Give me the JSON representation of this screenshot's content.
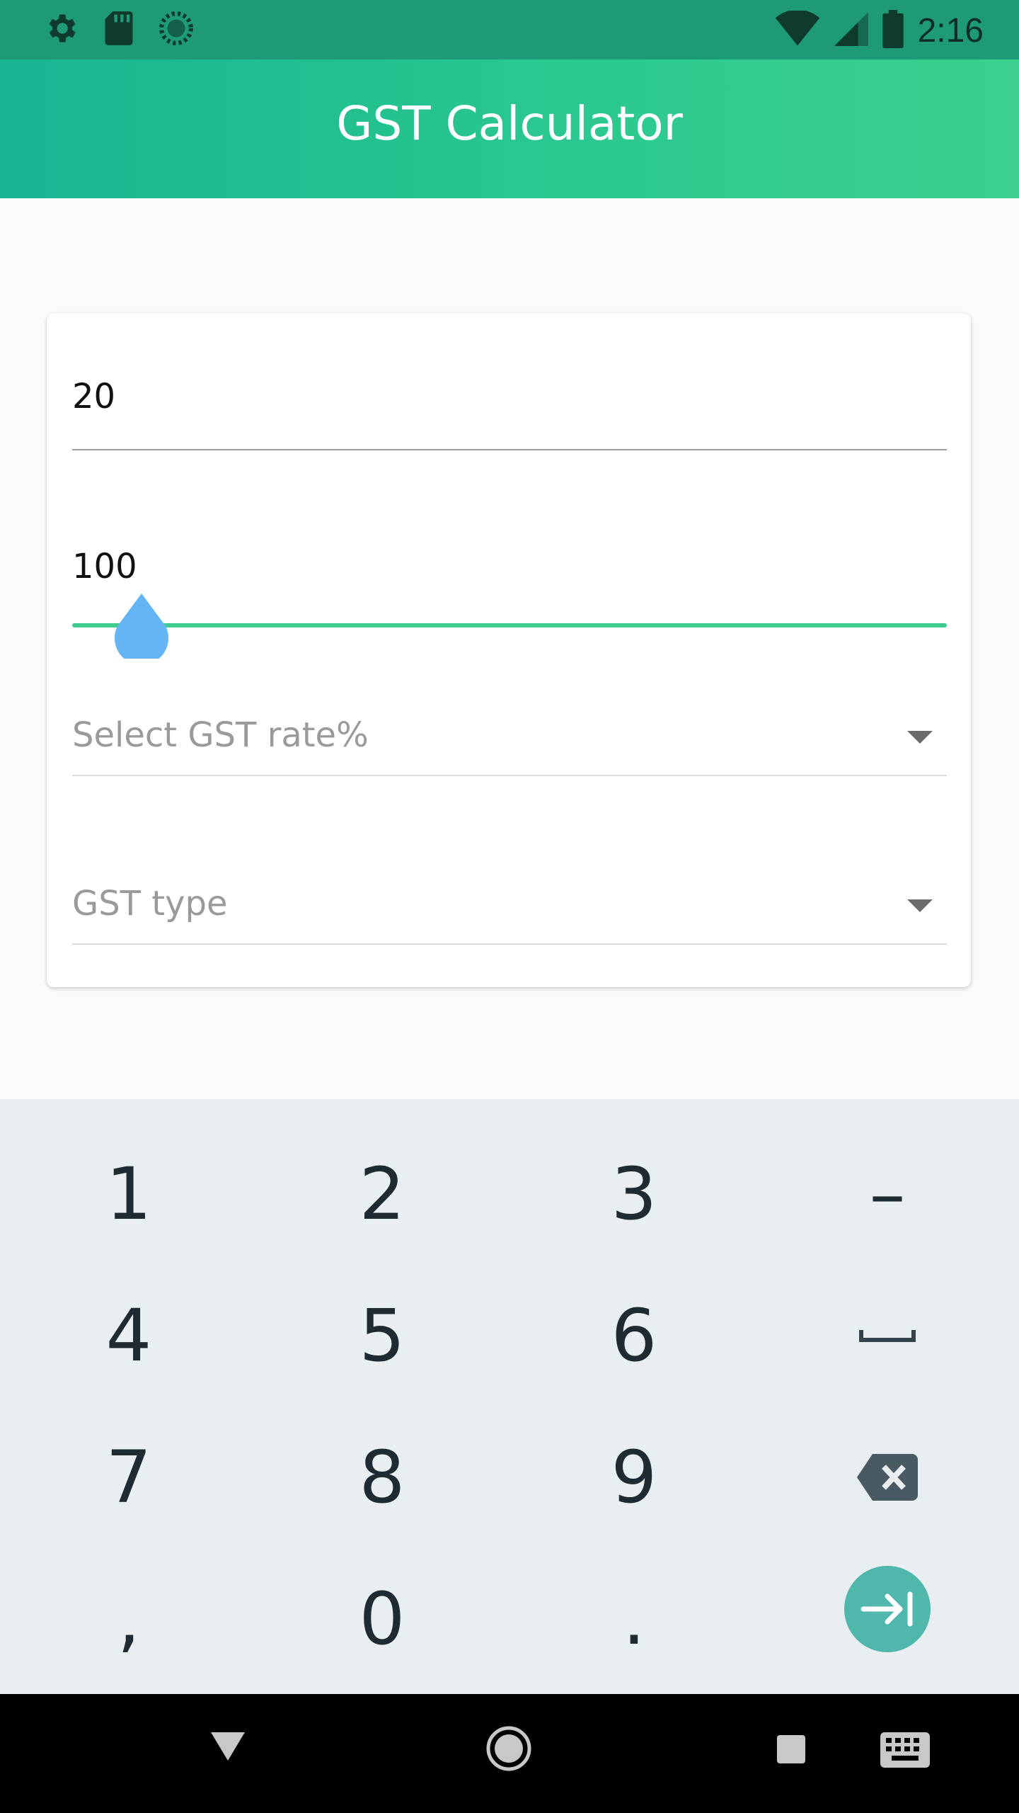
{
  "status_bar": {
    "time": "2:16",
    "left_icons": [
      "gear-icon",
      "sd-card-icon",
      "sync-icon"
    ],
    "right_icons": [
      "wifi-icon",
      "signal-icon",
      "battery-icon"
    ]
  },
  "app_bar": {
    "title": "GST Calculator"
  },
  "form": {
    "amount_field": {
      "value": "20"
    },
    "slider": {
      "value_label": "100",
      "level": 0.08
    },
    "gst_rate_dropdown": {
      "placeholder": "Select GST rate%"
    },
    "gst_type_dropdown": {
      "placeholder": "GST type"
    }
  },
  "keypad": {
    "rows": [
      [
        "1",
        "2",
        "3",
        "–"
      ],
      [
        "4",
        "5",
        "6",
        "space-icon"
      ],
      [
        "7",
        "8",
        "9",
        "backspace-icon"
      ],
      [
        ",",
        "0",
        ".",
        "next-icon"
      ]
    ]
  },
  "nav_bar": {
    "icons": [
      "back-icon",
      "home-icon",
      "recents-icon",
      "keyboard-icon"
    ]
  },
  "colors": {
    "accent": "#3fcb8f",
    "thumb": "#64b5f6",
    "header_start": "#17b592",
    "header_end": "#3ccf8e",
    "enter": "#4fb7ab"
  }
}
